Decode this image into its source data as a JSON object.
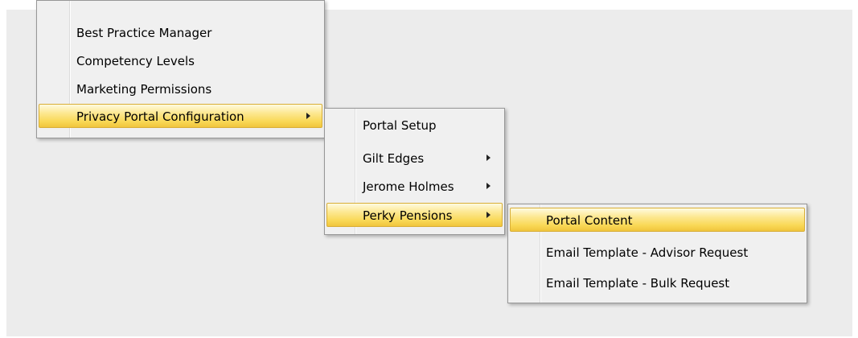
{
  "menu_level1": {
    "items": [
      {
        "label": "Best Practice Manager"
      },
      {
        "label": "Competency Levels"
      },
      {
        "label": "Marketing Permissions"
      },
      {
        "label": "Privacy Portal Configuration",
        "has_submenu": true,
        "highlighted": true
      }
    ]
  },
  "menu_level2": {
    "items": [
      {
        "label": "Portal Setup"
      },
      {
        "label": "Gilt Edges",
        "has_submenu": true
      },
      {
        "label": "Jerome Holmes",
        "has_submenu": true
      },
      {
        "label": "Perky Pensions",
        "has_submenu": true,
        "highlighted": true
      }
    ]
  },
  "menu_level3": {
    "items": [
      {
        "label": "Portal Content",
        "highlighted": true
      },
      {
        "label": "Email Template - Advisor Request"
      },
      {
        "label": "Email Template - Bulk Request"
      }
    ]
  },
  "colors": {
    "highlight_top": "#fde996",
    "highlight_bottom": "#f0c53d",
    "menu_background": "#f0f0f0",
    "desktop_background": "#ececec"
  }
}
